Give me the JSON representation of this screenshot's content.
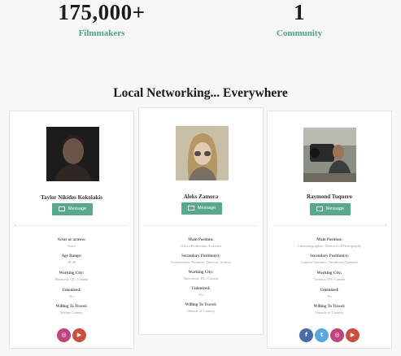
{
  "stats": [
    {
      "number": "175,000+",
      "label": "Filmmakers"
    },
    {
      "number": "1",
      "label": "Community"
    }
  ],
  "heading": "Local Networking... Everywhere",
  "message_label": "Message",
  "profiles": [
    {
      "name": "Taylor Nikides Kokolakis",
      "fields": [
        {
          "label": "Actor or actress:",
          "value": "Actor"
        },
        {
          "label": "Age Range:",
          "value": "18-26"
        },
        {
          "label": "Working City:",
          "value": "Montreal, QC, Canada"
        },
        {
          "label": "Unionized:",
          "value": "No"
        },
        {
          "label": "Willing To Travel:",
          "value": "Within Country"
        }
      ],
      "socials": [
        "instagram-icon",
        "youtube-icon"
      ]
    },
    {
      "name": "Aleks Zamora",
      "fields": [
        {
          "label": "Main Position:",
          "value": "Office Production Assistant"
        },
        {
          "label": "Secondary Position(s):",
          "value": "Screenwriter, Producer, Director, Actress"
        },
        {
          "label": "Working City:",
          "value": "Vancouver, BC, Canada"
        },
        {
          "label": "Unionized:",
          "value": "No"
        },
        {
          "label": "Willing To Travel:",
          "value": "Outside of Country"
        }
      ],
      "socials": []
    },
    {
      "name": "Raymond Tuquero",
      "fields": [
        {
          "label": "Main Position:",
          "value": "Cinematographer | Director of Photography"
        },
        {
          "label": "Secondary Position(s):",
          "value": "Camera Operator | Steadicam Operator"
        },
        {
          "label": "Working City:",
          "value": "Toronto, ON, Canada"
        },
        {
          "label": "Unionized:",
          "value": "No"
        },
        {
          "label": "Willing To Travel:",
          "value": "Outside of Country"
        }
      ],
      "socials": [
        "facebook-icon",
        "twitter-icon",
        "instagram-icon",
        "youtube-icon"
      ]
    }
  ],
  "colors": {
    "accent": "#58a88a",
    "stat_label": "#4fa383"
  }
}
